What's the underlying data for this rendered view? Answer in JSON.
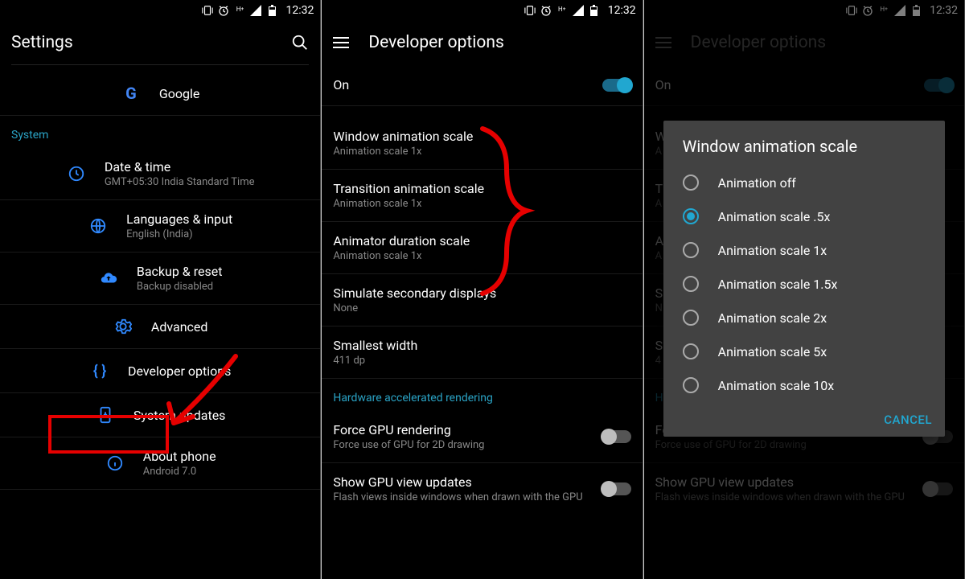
{
  "status": {
    "time": "12:32"
  },
  "colors": {
    "accent": "#21a7d0",
    "header_text": "#2aa3c5",
    "red": "#e60000"
  },
  "screen1": {
    "title": "Settings",
    "google": "Google",
    "section": "System",
    "items": {
      "datetime": {
        "label": "Date & time",
        "sub": "GMT+05:30 India Standard Time"
      },
      "lang": {
        "label": "Languages & input",
        "sub": "English (India)"
      },
      "backup": {
        "label": "Backup & reset",
        "sub": "Backup disabled"
      },
      "advanced": {
        "label": "Advanced"
      },
      "devopt": {
        "label": "Developer options"
      },
      "sysupd": {
        "label": "System updates"
      },
      "about": {
        "label": "About phone",
        "sub": "Android 7.0"
      }
    }
  },
  "screen2": {
    "title": "Developer options",
    "on_label": "On",
    "items": {
      "winanim": {
        "label": "Window animation scale",
        "sub": "Animation scale 1x"
      },
      "trananim": {
        "label": "Transition animation scale",
        "sub": "Animation scale 1x"
      },
      "duranim": {
        "label": "Animator duration scale",
        "sub": "Animation scale 1x"
      },
      "simdisp": {
        "label": "Simulate secondary displays",
        "sub": "None"
      },
      "smwidth": {
        "label": "Smallest width",
        "sub": "411 dp"
      },
      "hwar_header": "Hardware accelerated rendering",
      "forcegpu": {
        "label": "Force GPU rendering",
        "sub": "Force use of GPU for 2D drawing"
      },
      "showgpu": {
        "label": "Show GPU view updates",
        "sub": "Flash views inside windows when drawn with the GPU"
      }
    }
  },
  "screen3": {
    "title": "Developer options",
    "on_label": "On",
    "dialog": {
      "title": "Window animation scale",
      "options": [
        "Animation off",
        "Animation scale .5x",
        "Animation scale 1x",
        "Animation scale 1.5x",
        "Animation scale 2x",
        "Animation scale 5x",
        "Animation scale 10x"
      ],
      "selected_index": 1,
      "cancel": "CANCEL"
    },
    "bg": {
      "wlabel": "W",
      "wsub": "A",
      "tlabel": "T",
      "tsub": "A",
      "alabel": "A",
      "asub": "A",
      "slabel": "S",
      "ssub": "N",
      "swlabel": "S",
      "swsub": "4",
      "hwar": "H",
      "forcegpu": {
        "label": "Force GPU rendering",
        "sub": "Force use of GPU for 2D drawing"
      },
      "showgpu": {
        "label": "Show GPU view updates",
        "sub": "Flash views inside windows when drawn with the GPU"
      }
    }
  }
}
